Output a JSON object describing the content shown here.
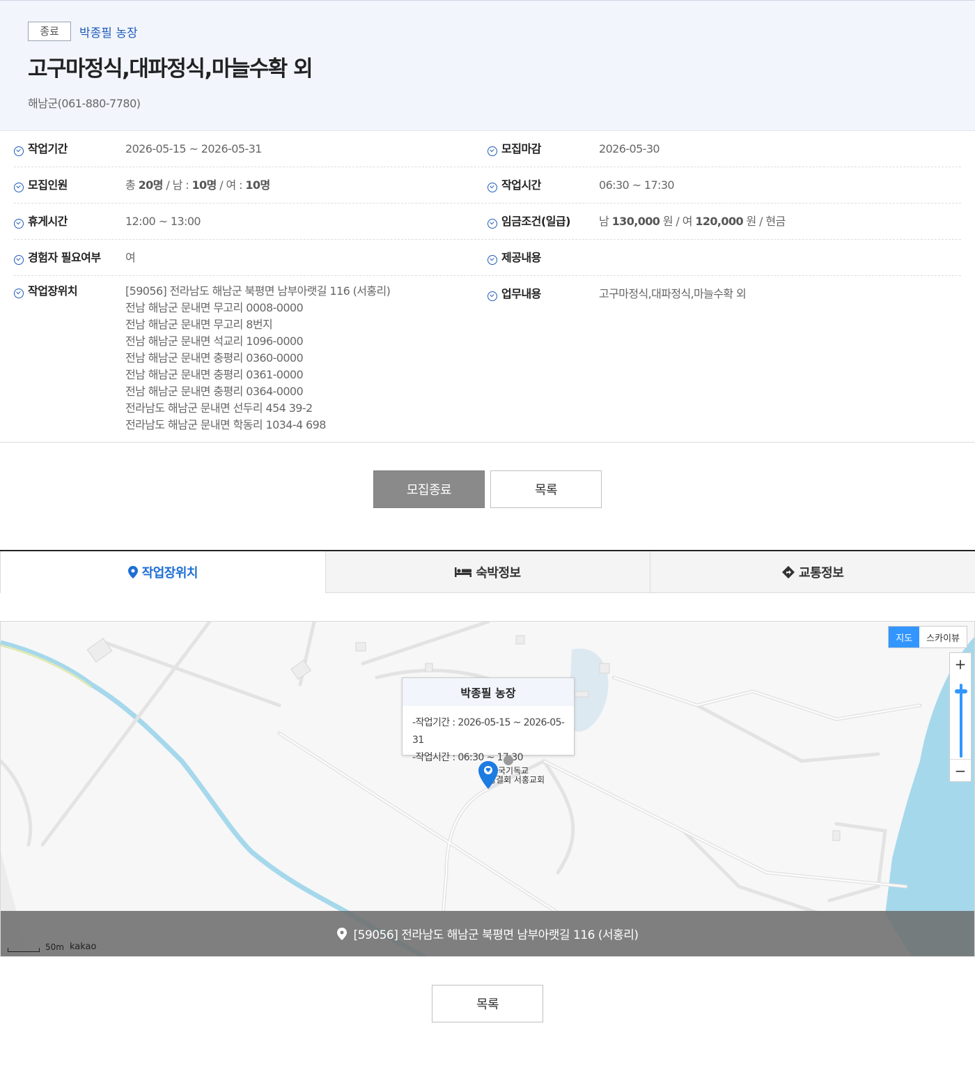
{
  "header": {
    "status_badge": "종료",
    "farm_name": "박종필 농장",
    "title": "고구마정식,대파정식,마늘수확 외",
    "region": "해남군(061-880-7780)"
  },
  "info": {
    "work_period_label": "작업기간",
    "work_period_value": "2026-05-15 ~ 2026-05-31",
    "deadline_label": "모집마감",
    "deadline_value": "2026-05-30",
    "recruit_label": "모집인원",
    "recruit_total_prefix": "총",
    "recruit_total": "20명",
    "recruit_male_prefix": "/ 남 :",
    "recruit_male": "10명",
    "recruit_female_prefix": "/ 여 :",
    "recruit_female": "10명",
    "work_time_label": "작업시간",
    "work_time_value": "06:30 ~ 17:30",
    "break_label": "휴게시간",
    "break_value": "12:00 ~ 13:00",
    "wage_label": "임금조건(일급)",
    "wage_male_prefix": "남",
    "wage_male": "130,000",
    "wage_mid": "원 / 여",
    "wage_female": "120,000",
    "wage_suffix": "원 / 현금",
    "experience_label": "경험자 필요여부",
    "experience_value": "여",
    "provided_label": "제공내용",
    "provided_value": "",
    "location_label": "작업장위치",
    "location_lines": [
      "[59056] 전라남도 해남군 북평면 남부아랫길 116 (서홍리)",
      "전남 해남군 문내면 무고리 0008-0000",
      "전남 해남군 문내면 무고리 8번지",
      "전남 해남군 문내면 석교리 1096-0000",
      "전남 해남군 문내면 충평리 0360-0000",
      "전남 해남군 문내면 충평리 0361-0000",
      "전남 해남군 문내면 충평리 0364-0000",
      "전라남도 해남군 문내면 선두리 454 39-2",
      "전라남도 해남군 문내면 학동리 1034-4 698"
    ],
    "task_label": "업무내용",
    "task_value": "고구마정식,대파정식,마늘수확 외"
  },
  "buttons": {
    "closed": "모집종료",
    "list": "목록",
    "list_bottom": "목록"
  },
  "tabs": {
    "location": "작업장위치",
    "lodging": "숙박정보",
    "traffic": "교통정보"
  },
  "map": {
    "type_map": "지도",
    "type_sky": "스카이뷰",
    "zoom_in": "+",
    "zoom_out": "−",
    "popup_title": "박종필 농장",
    "popup_period": "-작업기간 : 2026-05-15 ~ 2026-05-31",
    "popup_time": "-작업시간 : 06:30 ~ 17:30",
    "poi_line1": "국기독교",
    "poi_line2": "성결회 서홍교회",
    "address": "[59056] 전라남도 해남군 북평면 남부아랫길 116 (서홍리)",
    "scale": "50m",
    "logo": "kakao"
  },
  "colors": {
    "accent": "#1e5bb8",
    "tab_active": "#1e6ed6",
    "map_water": "#a6d8ec",
    "header_bg": "#f2f5fc"
  }
}
